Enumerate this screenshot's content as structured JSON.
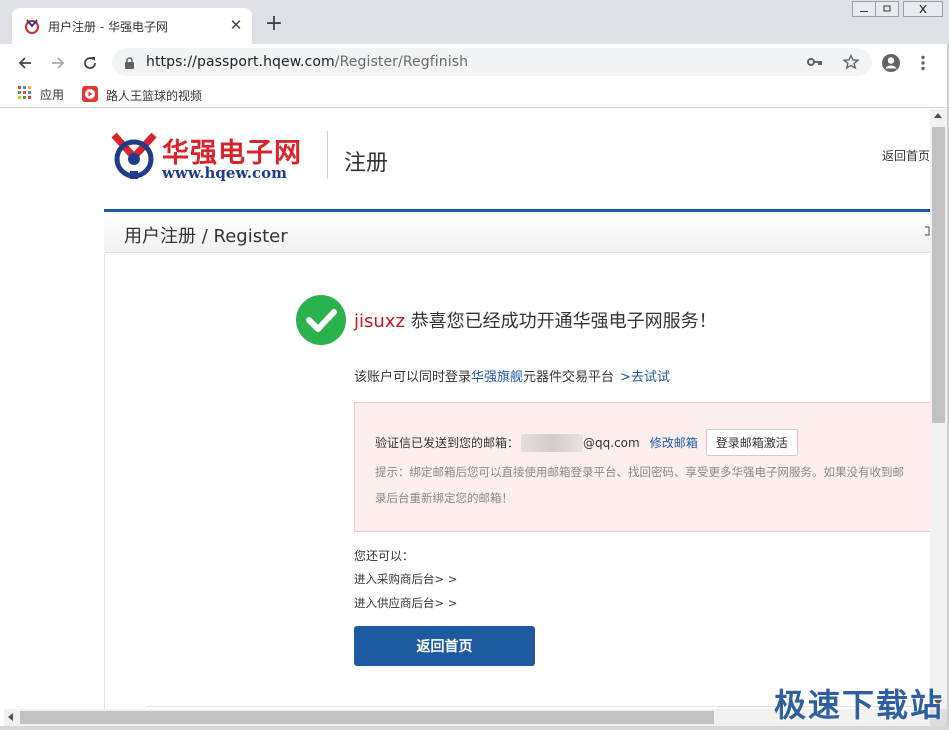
{
  "browser": {
    "tab_title": "用户注册 - 华强电子网",
    "tab_close": "✕",
    "new_tab": "+",
    "url_host": "https://passport.hqew.com",
    "url_path": "/Register/Regfinish",
    "bookmarks": [
      {
        "label": "应用"
      },
      {
        "label": "路人王篮球的视频"
      }
    ]
  },
  "header": {
    "logo_cn": "华强电子网",
    "logo_en": "www.hqew.com",
    "page_heading": "注册",
    "home_link": "返回首页"
  },
  "register_bar": {
    "title": "用户注册 / Register"
  },
  "success": {
    "username": "jisuxz",
    "message": "恭喜您已经成功开通华强电子网服务！"
  },
  "also_login": {
    "prefix": "该账户可以同时登录",
    "platform": "华强旗舰",
    "suffix": "元器件交易平台",
    "try_link": ">去试试"
  },
  "email_notice": {
    "label": "验证信已发送到您的邮箱：",
    "email_domain": "@qq.com",
    "modify_link": "修改邮箱",
    "activate_button": "登录邮箱激活",
    "tip_line1": "提示：绑定邮箱后您可以直接使用邮箱登录平台、找回密码、享受更多华强电子网服务。如果没有收到邮",
    "tip_line2": "录后台重新绑定您的邮箱！"
  },
  "next_steps": {
    "heading": "您还可以：",
    "links": [
      {
        "label": "进入采购商后台> >"
      },
      {
        "label": "进入供应商后台> >"
      }
    ]
  },
  "home_button": "返回首页",
  "watermark": "极速下载站",
  "colors": {
    "accent_blue": "#1d5aa0",
    "brand_red": "#d9232d",
    "success_green": "#2bb24c",
    "notice_bg": "#fdeeee"
  }
}
